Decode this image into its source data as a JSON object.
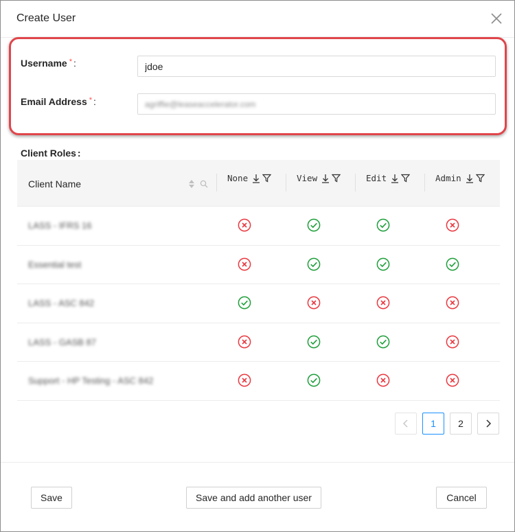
{
  "dialog": {
    "title": "Create User",
    "close_icon": "close-icon"
  },
  "form": {
    "username": {
      "label": "Username",
      "required_mark": "*",
      "colon": ":",
      "value": "jdoe"
    },
    "email": {
      "label": "Email Address",
      "required_mark": "*",
      "colon": ":",
      "value": "agriffie@leaseaccelerator.com"
    }
  },
  "client_roles": {
    "label": "Client Roles",
    "colon": ":",
    "columns": {
      "client_name": "Client Name",
      "none": "None",
      "view": "View",
      "edit": "Edit",
      "admin": "Admin"
    },
    "rows": [
      {
        "client": "LASS - IFRS 16",
        "none": "no",
        "view": "yes",
        "edit": "yes",
        "admin": "no"
      },
      {
        "client": "Essential test",
        "none": "no",
        "view": "yes",
        "edit": "yes",
        "admin": "yes"
      },
      {
        "client": "LASS - ASC 842",
        "none": "yes",
        "view": "no",
        "edit": "no",
        "admin": "no"
      },
      {
        "client": "LASS - GASB 87",
        "none": "no",
        "view": "yes",
        "edit": "yes",
        "admin": "no"
      },
      {
        "client": "Support - HP Testing - ASC 842",
        "none": "no",
        "view": "yes",
        "edit": "no",
        "admin": "no"
      }
    ]
  },
  "pagination": {
    "prev": "<",
    "pages": [
      "1",
      "2"
    ],
    "current": "1",
    "next": ">"
  },
  "footer": {
    "save": "Save",
    "save_and_add": "Save and add another user",
    "cancel": "Cancel"
  },
  "colors": {
    "yes": "#1e9e3a",
    "no": "#e8383f",
    "highlight": "#e0454a",
    "accent": "#1890ff"
  }
}
